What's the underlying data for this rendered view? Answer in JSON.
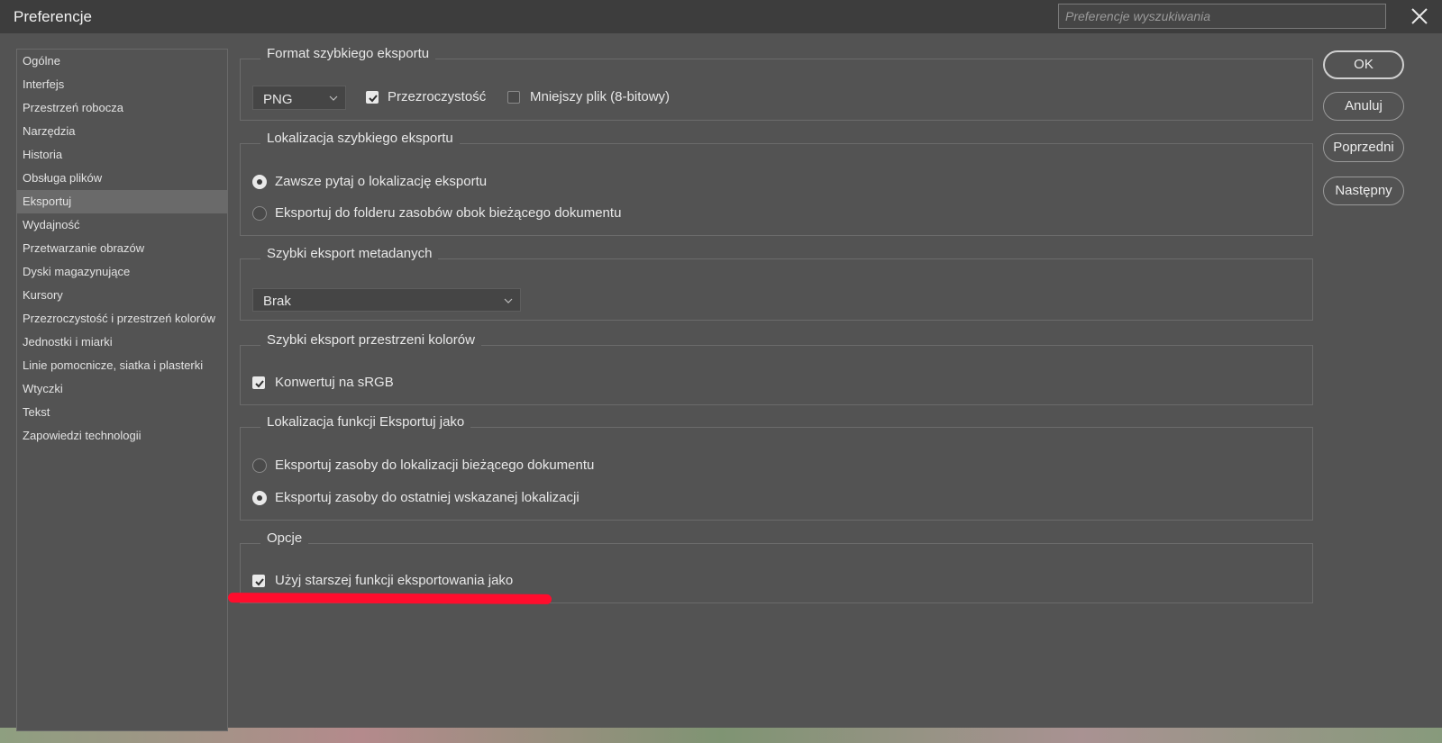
{
  "window": {
    "title": "Preferencje",
    "search_placeholder": "Preferencje wyszukiwania",
    "close_icon": "close-icon"
  },
  "sidebar": {
    "items": [
      {
        "label": "Ogólne",
        "selected": false
      },
      {
        "label": "Interfejs",
        "selected": false
      },
      {
        "label": "Przestrzeń robocza",
        "selected": false
      },
      {
        "label": "Narzędzia",
        "selected": false
      },
      {
        "label": "Historia",
        "selected": false
      },
      {
        "label": "Obsługa plików",
        "selected": false
      },
      {
        "label": "Eksportuj",
        "selected": true
      },
      {
        "label": "Wydajność",
        "selected": false
      },
      {
        "label": "Przetwarzanie obrazów",
        "selected": false
      },
      {
        "label": "Dyski magazynujące",
        "selected": false
      },
      {
        "label": "Kursory",
        "selected": false
      },
      {
        "label": "Przezroczystość i przestrzeń kolorów",
        "selected": false
      },
      {
        "label": "Jednostki i miarki",
        "selected": false
      },
      {
        "label": "Linie pomocnicze, siatka i plasterki",
        "selected": false
      },
      {
        "label": "Wtyczki",
        "selected": false
      },
      {
        "label": "Tekst",
        "selected": false
      },
      {
        "label": "Zapowiedzi technologii",
        "selected": false
      }
    ]
  },
  "groups": {
    "format": {
      "title": "Format szybkiego eksportu",
      "format_value": "PNG",
      "transparency_label": "Przezroczystość",
      "transparency_checked": true,
      "smaller_label": "Mniejszy plik (8-bitowy)",
      "smaller_checked": false
    },
    "location": {
      "title": "Lokalizacja szybkiego eksportu",
      "option_ask": "Zawsze pytaj o lokalizację eksportu",
      "option_folder": "Eksportuj do folderu zasobów obok bieżącego dokumentu",
      "selected": "ask"
    },
    "metadata": {
      "title": "Szybki eksport metadanych",
      "value": "Brak"
    },
    "colorspace": {
      "title": "Szybki eksport przestrzeni kolorów",
      "convert_label": "Konwertuj na sRGB",
      "convert_checked": true
    },
    "export_as": {
      "title": "Lokalizacja funkcji Eksportuj jako",
      "option_current": "Eksportuj zasoby do lokalizacji bieżącego dokumentu",
      "option_last": "Eksportuj zasoby do ostatniej wskazanej lokalizacji",
      "selected": "last"
    },
    "options": {
      "title": "Opcje",
      "legacy_label": "Użyj starszej funkcji eksportowania jako",
      "legacy_checked": true
    }
  },
  "buttons": {
    "ok": "OK",
    "cancel": "Anuluj",
    "prev": "Poprzedni",
    "next": "Następny"
  },
  "colors": {
    "dialog_bg": "#535353",
    "titlebar_bg": "#3d3d3d",
    "annotation": "#ff0d2d"
  }
}
